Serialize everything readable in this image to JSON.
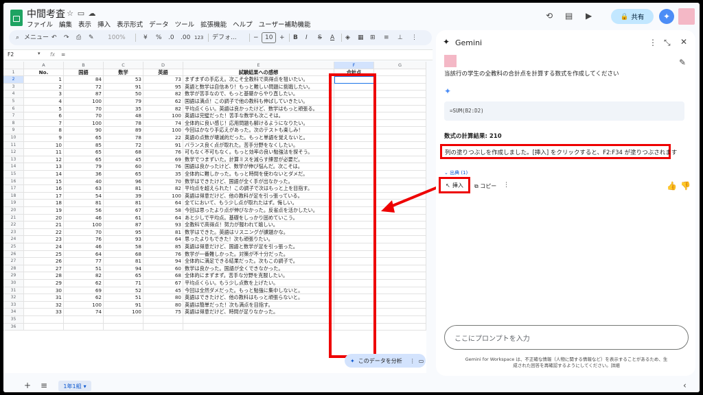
{
  "app": {
    "doc_title": "中間考査",
    "menu": [
      "ファイル",
      "編集",
      "表示",
      "挿入",
      "表示形式",
      "データ",
      "ツール",
      "拡張機能",
      "ヘルプ",
      "ユーザー補助機能"
    ],
    "share_label": "共有"
  },
  "toolbar": {
    "menu_search": "メニュー",
    "zoom": "100%",
    "currency": "¥",
    "percent": "%",
    "dec_less": ".0",
    "dec_more": ".00",
    "num_format": "123",
    "font": "デフォ...",
    "font_size": "10",
    "bold": "B",
    "italic": "I",
    "strike": "S",
    "text_color": "A"
  },
  "formula_bar": {
    "cell_ref": "F2",
    "fx": "fx",
    "value": "="
  },
  "sheet": {
    "columns": [
      "",
      "A",
      "B",
      "C",
      "D",
      "E",
      "F",
      "G"
    ],
    "header_row": [
      "No.",
      "国語",
      "数学",
      "英語",
      "試験結果への感想",
      "合計点",
      ""
    ],
    "rows": [
      [
        "1",
        "84",
        "53",
        "73",
        "まずまずの手応え。次こそ全教科で高得点を狙いたい。"
      ],
      [
        "2",
        "72",
        "91",
        "95",
        "英語と数学は自信あり！もっと難しい問題に挑戦したい。"
      ],
      [
        "3",
        "87",
        "50",
        "82",
        "数学が苦手なので、もっと基礎からやり直したい。"
      ],
      [
        "4",
        "100",
        "79",
        "62",
        "国語は満点！この調子で他の教科も伸ばしていきたい。"
      ],
      [
        "5",
        "70",
        "35",
        "82",
        "平均点くらい。英語は良かったけど、数学はもっと頑張る。"
      ],
      [
        "6",
        "70",
        "48",
        "100",
        "英語は完璧だった！苦手な数学も次こそは。"
      ],
      [
        "7",
        "100",
        "78",
        "74",
        "全体的に良い感じ！応用問題も解けるようになりたい。"
      ],
      [
        "8",
        "90",
        "89",
        "100",
        "今回はかなり手応えがあった。次のテストも楽しみ！"
      ],
      [
        "9",
        "65",
        "78",
        "22",
        "英語の点数が壊滅的だった。もっと単語を覚えないと。"
      ],
      [
        "10",
        "85",
        "72",
        "91",
        "バランス良く点が取れた。苦手分野をなくしたい。"
      ],
      [
        "11",
        "65",
        "68",
        "76",
        "可もなく不可もなく。もっと効率の良い勉強法を探そう。"
      ],
      [
        "12",
        "65",
        "45",
        "69",
        "数学でつまずいた。計算ミスを減らす練習が必要だ。"
      ],
      [
        "13",
        "79",
        "60",
        "76",
        "国語は良かったけど、数学が伸び悩んだ。次こそは。"
      ],
      [
        "14",
        "36",
        "65",
        "35",
        "全体的に難しかった。もっと時間を使わないとダメだ。"
      ],
      [
        "15",
        "40",
        "96",
        "70",
        "数学はできたけど、国語が全く手が出なかった。"
      ],
      [
        "16",
        "63",
        "81",
        "82",
        "平均点を超えられた！この調子で次はもっと上を目指す。"
      ],
      [
        "17",
        "54",
        "39",
        "100",
        "英語は得意だけど、他の教科が足を引っ張っている。"
      ],
      [
        "18",
        "81",
        "81",
        "64",
        "全てにおいて、もう少し点が取れたはず。悔しい。"
      ],
      [
        "19",
        "56",
        "67",
        "58",
        "今回は思ったより点が伸びなかった。反省点を活かしたい。"
      ],
      [
        "20",
        "46",
        "61",
        "64",
        "あと少しで平均点。基礎をしっかり固めていこう。"
      ],
      [
        "21",
        "100",
        "87",
        "93",
        "全教科で高得点！努力が報われて嬉しい。"
      ],
      [
        "22",
        "70",
        "95",
        "81",
        "数学はできた。英語はリスニングが課題かな。"
      ],
      [
        "23",
        "76",
        "93",
        "64",
        "思ったよりもできた！次も頑張りたい。"
      ],
      [
        "24",
        "46",
        "58",
        "85",
        "英語は得意だけど、国語と数学が足を引っ張った。"
      ],
      [
        "25",
        "64",
        "68",
        "76",
        "数学が一番難しかった。対策が不十分だった。"
      ],
      [
        "26",
        "77",
        "81",
        "94",
        "全体的に満足できる結果だった。次もこの調子で。"
      ],
      [
        "27",
        "51",
        "94",
        "60",
        "数学は良かった。国語が全くできなかった。"
      ],
      [
        "28",
        "82",
        "65",
        "68",
        "全体的にまずまず。苦手な分野を克服したい。"
      ],
      [
        "29",
        "62",
        "71",
        "67",
        "平均点くらい。もう少し点数を上げたい。"
      ],
      [
        "30",
        "69",
        "52",
        "45",
        "今回は全然ダメだった。もっと勉強に集中しないと。"
      ],
      [
        "31",
        "62",
        "51",
        "80",
        "英語はできたけど、他の教科はもっと頑張らないと。"
      ],
      [
        "32",
        "100",
        "91",
        "80",
        "英語は簡単だった！次も満点を目指す。"
      ],
      [
        "33",
        "74",
        "100",
        "75",
        "英語は得意だけど、時間が足りなかった。"
      ]
    ],
    "extra_row_numbers": [
      "35",
      "36"
    ],
    "sheet_tab": "1年1組",
    "analyze_chip": "このデータを分析"
  },
  "gemini": {
    "title": "Gemini",
    "prompt": "当該行の学生の全教科の合計点を計算する数式を作成してください",
    "formula": "=SUM(B2:D2)",
    "result": "数式の計算結果: 210",
    "answer": "列の塗りつぶしを作成しました。[挿入] をクリックすると、F2:F34 が塗りつぶされます",
    "sources": "出典 (1)",
    "insert_label": "挿入",
    "copy_label": "コピー",
    "input_placeholder": "ここにプロンプトを入力",
    "disclaimer": "Gemini for Workspace は、不正確な情報（人物に関する情報など）を表示することがあるため、生成された回答を再確認するようにしてください。詳細"
  },
  "colors": {
    "accent": "#0b57d0",
    "highlight": "#ee0000",
    "sheets_green": "#1ea362"
  }
}
